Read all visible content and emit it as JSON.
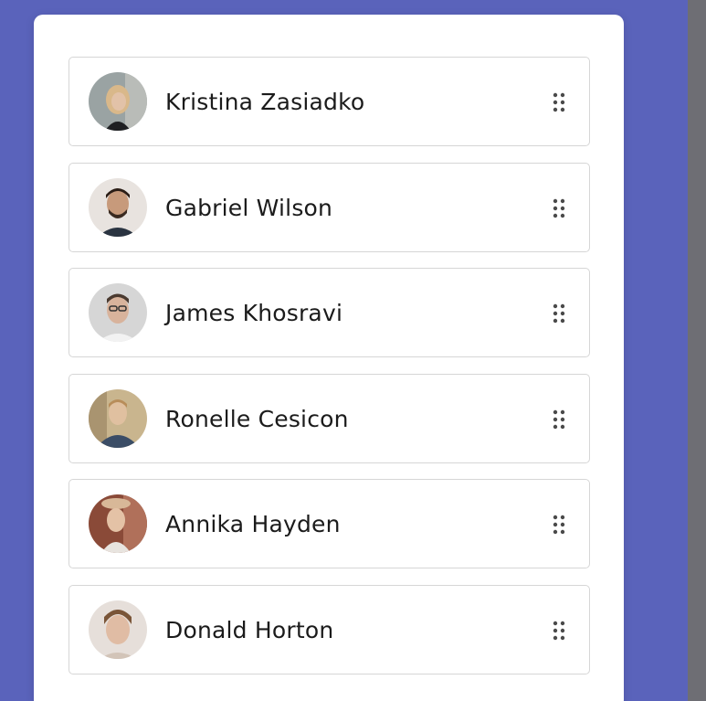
{
  "colors": {
    "background": "#5a63bb",
    "card": "#ffffff",
    "item_border": "#d6d6d6",
    "text": "#1b1b1b",
    "handle": "#4a4a4a"
  },
  "list": {
    "items": [
      {
        "name": "Kristina Zasiadko",
        "avatar": "person-photo",
        "handle_icon": "drag-handle-icon"
      },
      {
        "name": "Gabriel Wilson",
        "avatar": "person-photo",
        "handle_icon": "drag-handle-icon"
      },
      {
        "name": "James Khosravi",
        "avatar": "person-photo",
        "handle_icon": "drag-handle-icon"
      },
      {
        "name": "Ronelle Cesicon",
        "avatar": "person-photo",
        "handle_icon": "drag-handle-icon"
      },
      {
        "name": "Annika Hayden",
        "avatar": "person-photo",
        "handle_icon": "drag-handle-icon"
      },
      {
        "name": "Donald Horton",
        "avatar": "person-photo",
        "handle_icon": "drag-handle-icon"
      }
    ]
  }
}
